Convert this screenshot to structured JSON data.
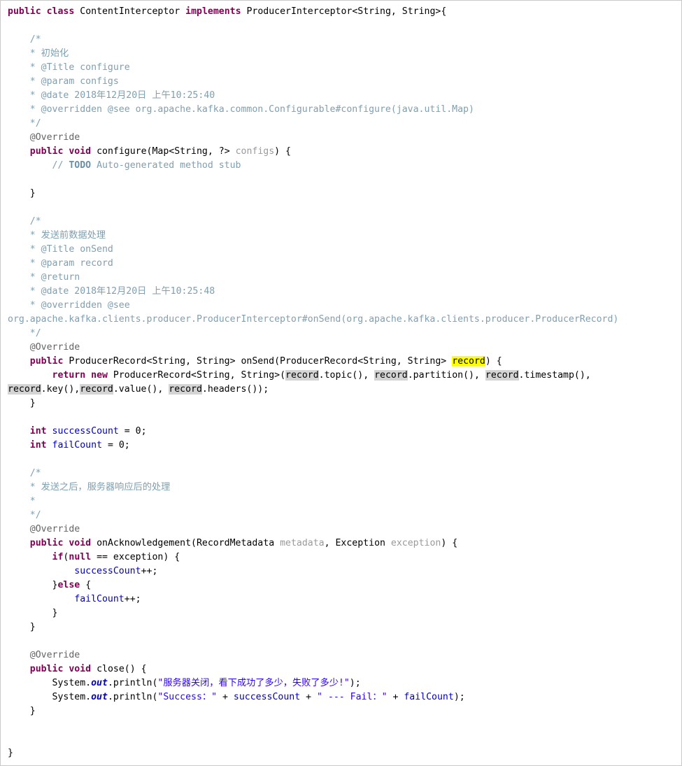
{
  "editor": {
    "language": "java",
    "class_name": "ContentInterceptor",
    "interface_name": "ProducerInterceptor<String, String>",
    "background": "#ffffff",
    "border_color": "#c9c9c9"
  },
  "theme": {
    "keyword": "#7f0055",
    "comment": "#7f9fb0",
    "javadoc": "#7f9fb0",
    "annotation": "#646464",
    "string": "#2a00ff",
    "field": "#0000c0",
    "parameter": "#9a9a9a",
    "plain": "#000000",
    "todo_tag": "#6a8fa8",
    "occurrence_highlight": "#d4d4d4",
    "declaration_highlight": "#ffff00"
  },
  "code": {
    "line_01": "public class ContentInterceptor implements ProducerInterceptor<String, String>{",
    "kw_public": "public",
    "kw_class": "class",
    "kw_implements": "implements",
    "kw_void": "void",
    "kw_return": "return",
    "kw_new": "new",
    "kw_int": "int",
    "kw_if": "if",
    "kw_else": "else",
    "kw_null": "null",
    "type_producerinterceptor": " ProducerInterceptor<String, String>{",
    "cmt_open": "/*",
    "cmt_close": " */",
    "cmt_star": " *",
    "c1_title_cn": " * 初始化",
    "c1_title": " * @Title configure",
    "c1_param": " * @param configs",
    "c1_date": " * @date 2018年12月20日 上午10:25:40",
    "c1_overridden": " * @overridden @see org.apache.kafka.common.Configurable#configure(java.util.Map)",
    "annotation_override": "@Override",
    "configure_sig_rest": " configure(Map<String, ?> configs) {",
    "configure_name": "configure(Map<String, ?> ",
    "param_configs": "configs",
    "todo_slashes": "// ",
    "todo_word": "TODO",
    "todo_rest": " Auto-generated method stub",
    "brace_close": "}",
    "c2_title_cn": " * 发送前数据处理",
    "c2_title": " * @Title onSend",
    "c2_param": " * @param record",
    "c2_return": " * @return",
    "c2_date": " * @date 2018年12月20日 上午10:25:48",
    "c2_overridden_head": " * @overridden @see",
    "c2_overridden_wrap": "org.apache.kafka.clients.producer.ProducerInterceptor#onSend(org.apache.kafka.clients.producer.ProducerRecord)",
    "onsend_sig_a": " ProducerRecord<String, String> onSend(ProducerRecord<String, String> ",
    "onsend_record": "record",
    "onsend_sig_b": ") {",
    "return_type": " ProducerRecord<String, String>(",
    "record_token": "record",
    "ret_topic": ".topic(), ",
    "ret_partition": ".partition(), ",
    "ret_timestamp": ".timestamp(),",
    "ret_key": ".key(),",
    "ret_value": ".value(), ",
    "ret_headers": ".headers());",
    "field_successcount": "successCount",
    "field_failcount": "failCount",
    "assign_zero": " = 0;",
    "c3_title_cn": " * 发送之后，服务器响应后的处理",
    "onack_sig_a": " onAcknowledgement(RecordMetadata ",
    "param_metadata": "metadata",
    "onack_sig_b": ", Exception ",
    "param_exception": "exception",
    "onack_sig_c": ") {",
    "if_open": "(",
    "if_cond_rest": " == exception) {",
    "inc": "++;",
    "else_open": "} ",
    "else_brace": " {",
    "close_sig": " close() {",
    "sysout_prefix": "System.",
    "sysout_out": "out",
    "sysout_println": ".println(",
    "str_cn": "\"服务器关闭，看下成功了多少，失败了多少!\"",
    "str_success": "\"Success：\"",
    "str_fail": "\" --- Fail：\"",
    "plus": " + ",
    "semi_paren": ");"
  }
}
